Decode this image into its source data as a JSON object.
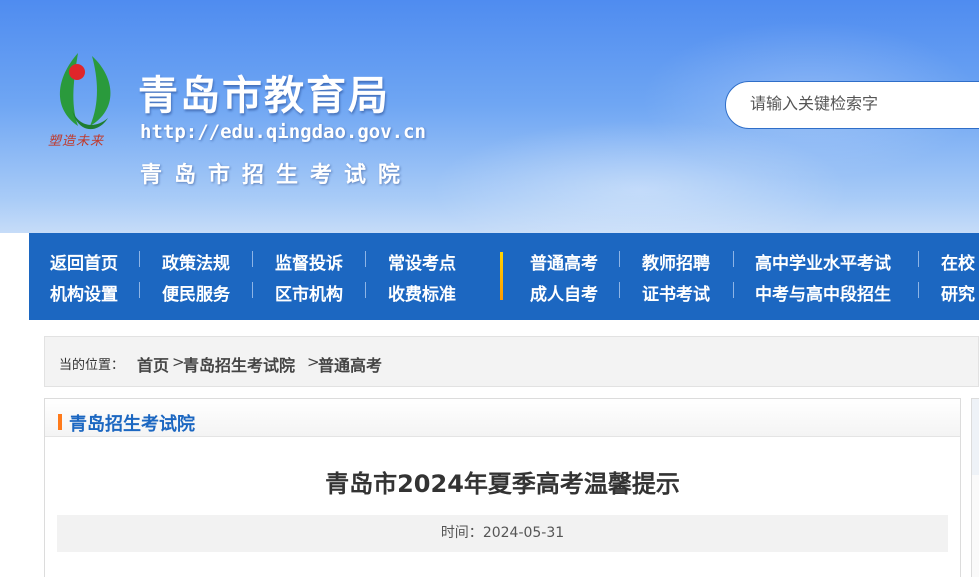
{
  "header": {
    "site_title": "青岛市教育局",
    "site_url": "http://edu.qingdao.gov.cn",
    "site_subtitle": "青岛市招生考试院",
    "logo_slogan": "塑造未来"
  },
  "search": {
    "placeholder": "请输入关键检索字"
  },
  "nav": {
    "row1": [
      "返回首页",
      "政策法规",
      "监督投诉",
      "常设考点",
      "普通高考",
      "教师招聘",
      "高中学业水平考试",
      "在校"
    ],
    "row2": [
      "机构设置",
      "便民服务",
      "区市机构",
      "收费标准",
      "成人自考",
      "证书考试",
      "中考与高中段招生",
      "研究"
    ]
  },
  "breadcrumb": {
    "label": "当的位置：",
    "items": [
      "首页",
      "青岛招生考试院",
      "普通高考"
    ],
    "separator": ">"
  },
  "panel": {
    "title": "青岛招生考试院"
  },
  "article": {
    "title": "青岛市2024年夏季高考温馨提示",
    "date_label": "时间：",
    "date": "2024-05-31"
  },
  "colors": {
    "nav_bg": "#1c67c1",
    "accent_orange": "#ff7a1a",
    "banner_top": "#4f8cf0"
  }
}
